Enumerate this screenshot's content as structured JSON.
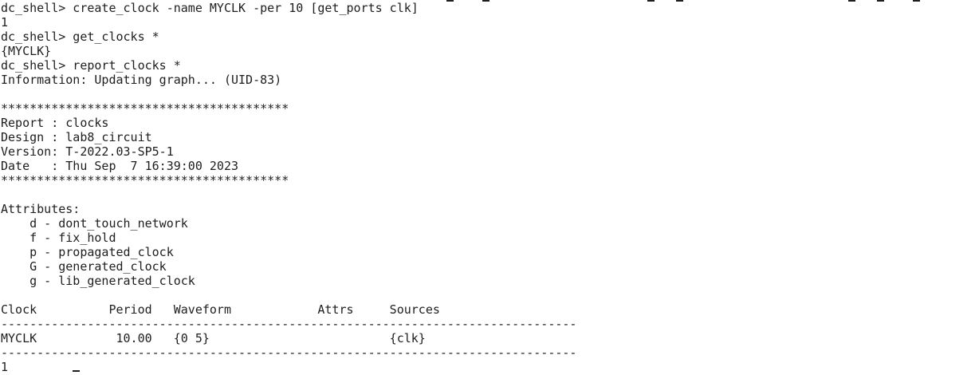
{
  "terminal": {
    "lines": [
      "dc_shell> create_clock -name MYCLK -per 10 [get_ports clk]",
      "1",
      "dc_shell> get_clocks *",
      "{MYCLK}",
      "dc_shell> report_clocks *",
      "Information: Updating graph... (UID-83)",
      "",
      "****************************************",
      "Report : clocks",
      "Design : lab8_circuit",
      "Version: T-2022.03-SP5-1",
      "Date   : Thu Sep  7 16:39:00 2023",
      "****************************************",
      "",
      "Attributes:",
      "    d - dont_touch_network",
      "    f - fix_hold",
      "    p - propagated_clock",
      "    G - generated_clock",
      "    g - lib_generated_clock",
      "",
      "Clock          Period   Waveform            Attrs     Sources",
      "--------------------------------------------------------------------------------",
      "MYCLK           10.00   {0 5}                         {clk}",
      "--------------------------------------------------------------------------------",
      "1"
    ]
  }
}
